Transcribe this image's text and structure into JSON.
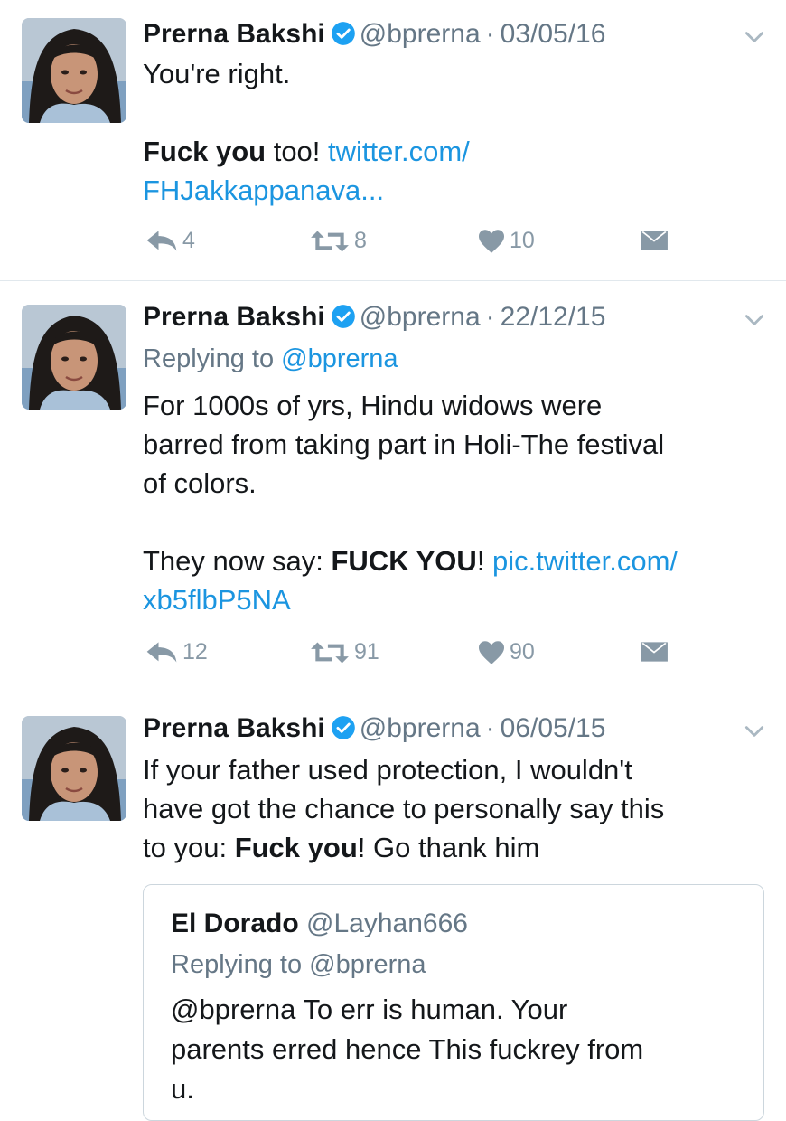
{
  "tweets": [
    {
      "name": "Prerna Bakshi",
      "handle": "@bprerna",
      "date": "03/05/16",
      "line1": "You're right.",
      "line2_bold": "Fuck you",
      "line2_rest": " too! ",
      "link1": "twitter.com/",
      "link2": "FHJakkappanava...",
      "replies": "4",
      "retweets": "8",
      "likes": "10"
    },
    {
      "name": "Prerna Bakshi",
      "handle": "@bprerna",
      "date": "22/12/15",
      "replying_prefix": "Replying to ",
      "replying_handle": "@bprerna",
      "p1_l1": "For 1000s of yrs, Hindu widows were",
      "p1_l2": "barred from taking part in Holi-The festival",
      "p1_l3": "of colors.",
      "p2_pre": "They now say: ",
      "p2_bold": "FUCK YOU",
      "p2_post": "! ",
      "link1": "pic.twitter.com/",
      "link2": "xb5flbP5NA",
      "replies": "12",
      "retweets": "91",
      "likes": "90"
    },
    {
      "name": "Prerna Bakshi",
      "handle": "@bprerna",
      "date": "06/05/15",
      "l1": "If your father used protection, I wouldn't",
      "l2": "have got the chance to personally say this",
      "l3_pre": "to you: ",
      "l3_bold": "Fuck you",
      "l3_post": "! Go thank him"
    }
  ],
  "quoted": {
    "name": "El Dorado",
    "handle": "@Layhan666",
    "replying_prefix": "Replying to ",
    "replying_handle": "@bprerna",
    "l1": "@bprerna To err is human. Your",
    "l2": "parents erred hence This fuckrey from",
    "l3": "u."
  },
  "colors": {
    "link": "#1b95e0",
    "muted": "#657786",
    "icon": "#8899a6",
    "verified": "#1da1f2"
  }
}
